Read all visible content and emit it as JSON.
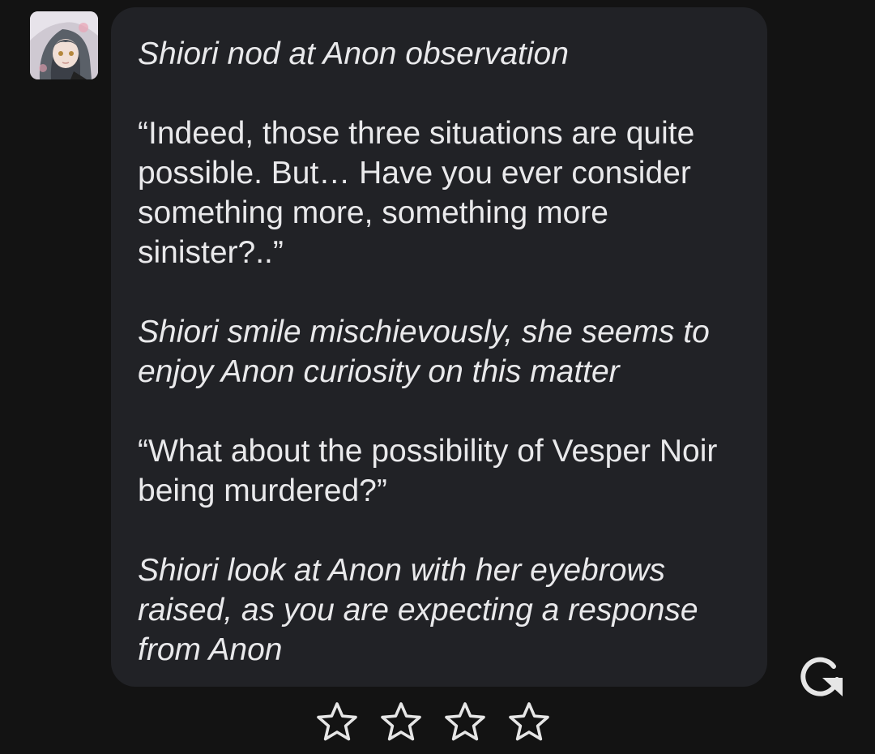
{
  "message": {
    "paragraphs": [
      {
        "kind": "narration",
        "text": "Shiori nod at Anon observation"
      },
      {
        "kind": "dialogue",
        "text": "“Indeed, those three situations are quite possible. But… Have you ever consider something more, something more sinister?..”"
      },
      {
        "kind": "narration",
        "text": "Shiori smile mischievously, she seems to enjoy Anon curiosity on this matter"
      },
      {
        "kind": "dialogue",
        "text": "“What about the possibility of Vesper Noir being murdered?”"
      },
      {
        "kind": "narration",
        "text": "Shiori look at Anon with her eyebrows raised, as you are expecting a response from Anon"
      }
    ]
  },
  "icons": {
    "regenerate": "refresh-icon",
    "rating_star": "star-outline-icon"
  },
  "rating": {
    "max": 4,
    "value": 0
  },
  "colors": {
    "background": "#131313",
    "bubble": "#212226",
    "text": "#e9e9eb",
    "icon": "#e6e6e6"
  }
}
